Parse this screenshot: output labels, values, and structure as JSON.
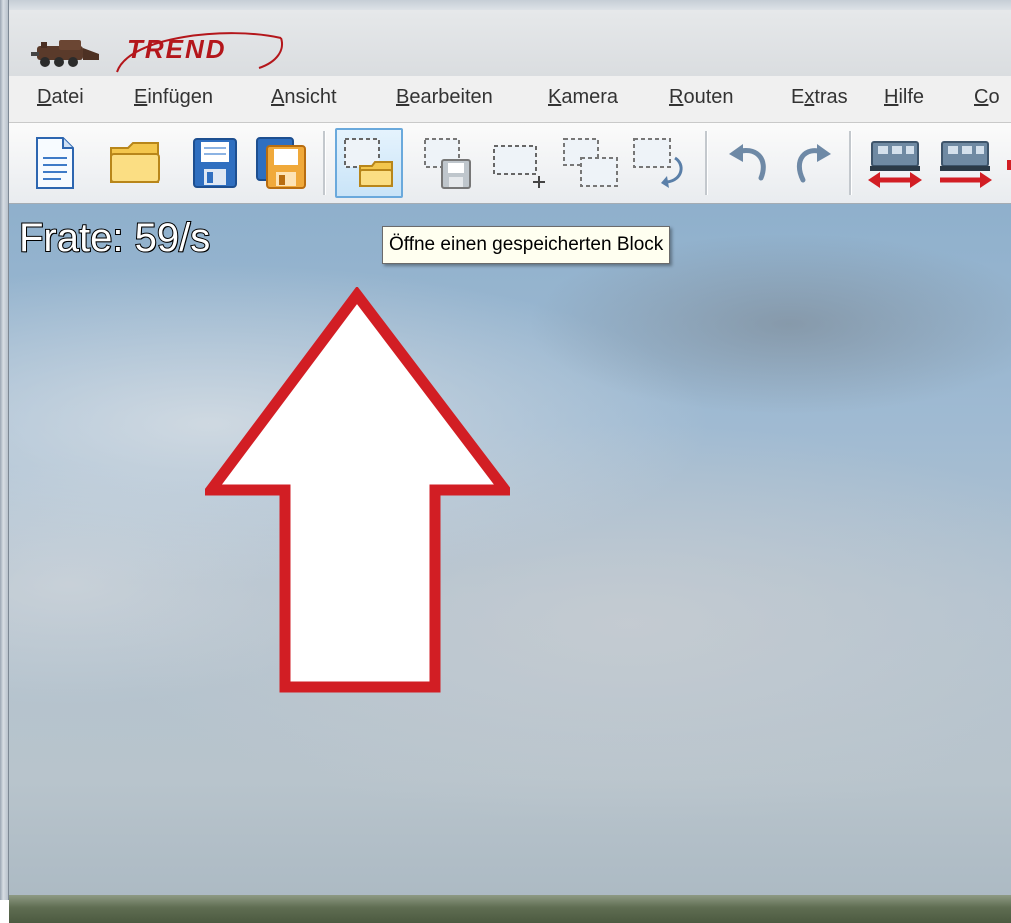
{
  "app": {
    "logo_text": "TREND"
  },
  "menu": [
    {
      "pre": "",
      "ul": "D",
      "post": "atei"
    },
    {
      "pre": "",
      "ul": "E",
      "post": "infügen"
    },
    {
      "pre": "",
      "ul": "A",
      "post": "nsicht"
    },
    {
      "pre": "",
      "ul": "B",
      "post": "earbeiten"
    },
    {
      "pre": "",
      "ul": "K",
      "post": "amera"
    },
    {
      "pre": "",
      "ul": "R",
      "post": "outen"
    },
    {
      "pre": "E",
      "ul": "x",
      "post": "tras"
    },
    {
      "pre": "",
      "ul": "H",
      "post": "ilfe"
    },
    {
      "pre": "",
      "ul": "C",
      "post": "o"
    }
  ],
  "toolbar": {
    "icons": [
      "new-document",
      "open-folder",
      "save",
      "save-as",
      "open-block",
      "save-block",
      "select-block",
      "copy-block",
      "rotate-block",
      "undo",
      "redo",
      "train-left",
      "train-right"
    ],
    "active": "open-block"
  },
  "viewport": {
    "frame_rate": "Frate: 59/s",
    "tooltip": "Öffne einen gespeicherten Block"
  },
  "colors": {
    "logo": "#b4161b",
    "arrow_outline": "#d21e24",
    "active_button": "#6aa9dc"
  }
}
